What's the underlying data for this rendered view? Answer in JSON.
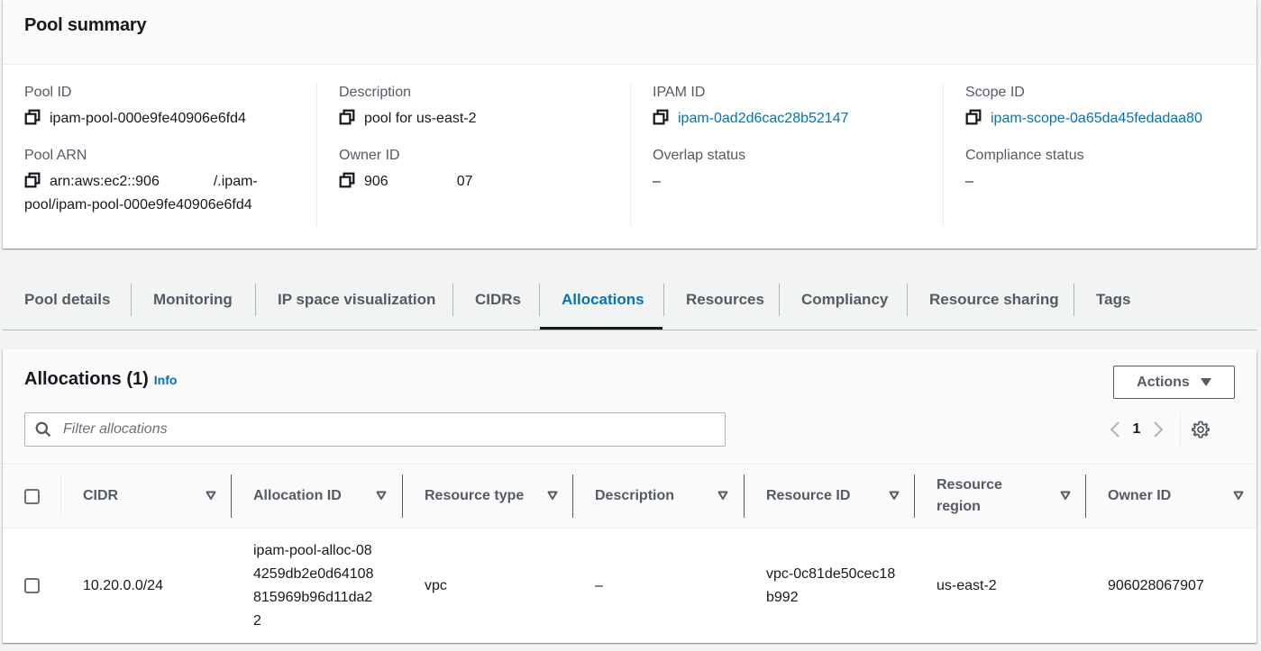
{
  "summary": {
    "title": "Pool summary",
    "fields": {
      "pool_id": {
        "label": "Pool ID",
        "value": "ipam-pool-000e9fe40906e6fd4"
      },
      "pool_arn": {
        "label": "Pool ARN",
        "value_line1_start": "arn:aws:ec2::906",
        "value_line1_end": "/.ipam-",
        "value_line2": "pool/ipam-pool-000e9fe40906e6fd4"
      },
      "description": {
        "label": "Description",
        "value": "pool for us-east-2"
      },
      "owner_id": {
        "label": "Owner ID",
        "value_start": "906",
        "value_end": "07"
      },
      "ipam_id": {
        "label": "IPAM ID",
        "value": "ipam-0ad2d6cac28b52147"
      },
      "overlap_status": {
        "label": "Overlap status",
        "value": "–"
      },
      "scope_id": {
        "label": "Scope ID",
        "value": "ipam-scope-0a65da45fedadaa80"
      },
      "compliance_status": {
        "label": "Compliance status",
        "value": "–"
      }
    }
  },
  "tabs": [
    {
      "label": "Pool details",
      "active": false
    },
    {
      "label": "Monitoring",
      "active": false
    },
    {
      "label": "IP space visualization",
      "active": false
    },
    {
      "label": "CIDRs",
      "active": false
    },
    {
      "label": "Allocations",
      "active": true
    },
    {
      "label": "Resources",
      "active": false
    },
    {
      "label": "Compliancy",
      "active": false
    },
    {
      "label": "Resource sharing",
      "active": false
    },
    {
      "label": "Tags",
      "active": false
    }
  ],
  "allocations": {
    "title": "Allocations (1)",
    "info_label": "Info",
    "actions_label": "Actions",
    "filter_placeholder": "Filter allocations",
    "filter_value": "",
    "page": "1",
    "columns": [
      "CIDR",
      "Allocation ID",
      "Resource type",
      "Description",
      "Resource ID",
      "Resource region",
      "Owner ID"
    ],
    "rows": [
      {
        "cidr": "10.20.0.0/24",
        "allocation_id": "ipam-pool-alloc-084259db2e0d64108815969b96d11da22",
        "resource_type": "vpc",
        "description": "–",
        "resource_id": "vpc-0c81de50cec18b992",
        "resource_region": "us-east-2",
        "owner_id": "906028067907"
      }
    ]
  },
  "colors": {
    "link": "#0073bb",
    "text": "#16191f",
    "secondary_text": "#545b64",
    "page_bg": "#f2f3f3"
  }
}
